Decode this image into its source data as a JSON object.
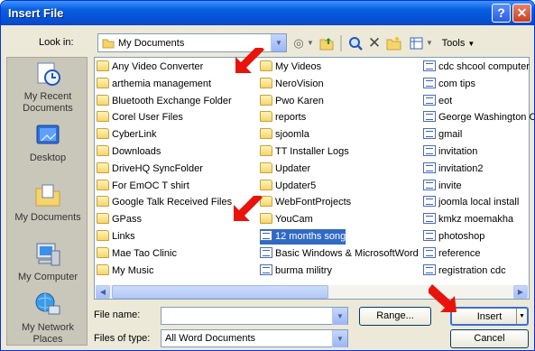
{
  "window": {
    "title": "Insert File",
    "help_label": "?",
    "close_label": "✕"
  },
  "toolbar": {
    "look_in_label": "Look in:",
    "look_in_value": "My Documents",
    "tools_label": "Tools"
  },
  "places": [
    {
      "label": "My Recent Documents",
      "icon": "recent-documents-icon"
    },
    {
      "label": "Desktop",
      "icon": "desktop-icon"
    },
    {
      "label": "My Documents",
      "icon": "my-documents-icon"
    },
    {
      "label": "My Computer",
      "icon": "my-computer-icon"
    },
    {
      "label": "My Network Places",
      "icon": "network-places-icon"
    }
  ],
  "files": {
    "col1": [
      {
        "name": "Any Video Converter",
        "type": "folder"
      },
      {
        "name": "arthemia management",
        "type": "folder"
      },
      {
        "name": "Bluetooth Exchange Folder",
        "type": "folder"
      },
      {
        "name": "Corel User Files",
        "type": "folder"
      },
      {
        "name": "CyberLink",
        "type": "folder"
      },
      {
        "name": "Downloads",
        "type": "folder"
      },
      {
        "name": "DriveHQ SyncFolder",
        "type": "folder"
      },
      {
        "name": "For EmOC T shirt",
        "type": "folder"
      },
      {
        "name": "Google Talk Received Files",
        "type": "folder"
      },
      {
        "name": "GPass",
        "type": "folder"
      },
      {
        "name": "Links",
        "type": "folder"
      },
      {
        "name": "Mae Tao Clinic",
        "type": "folder"
      },
      {
        "name": "My Music",
        "type": "folder"
      }
    ],
    "col2": [
      {
        "name": "My Videos",
        "type": "folder"
      },
      {
        "name": "NeroVision",
        "type": "folder"
      },
      {
        "name": "Pwo Karen",
        "type": "folder"
      },
      {
        "name": "reports",
        "type": "folder"
      },
      {
        "name": "sjoomla",
        "type": "folder"
      },
      {
        "name": "TT Installer Logs",
        "type": "folder"
      },
      {
        "name": "Updater",
        "type": "folder"
      },
      {
        "name": "Updater5",
        "type": "folder"
      },
      {
        "name": "WebFontProjects",
        "type": "folder"
      },
      {
        "name": "YouCam",
        "type": "folder"
      },
      {
        "name": "12 months song",
        "type": "doc",
        "selected": true
      },
      {
        "name": "Basic Windows & MicrosoftWord",
        "type": "doc"
      },
      {
        "name": "burma militry",
        "type": "doc"
      }
    ],
    "col3": [
      {
        "name": "cdc shcool computer",
        "type": "doc"
      },
      {
        "name": "com tips",
        "type": "doc"
      },
      {
        "name": "eot",
        "type": "doc"
      },
      {
        "name": "George Washington C",
        "type": "doc"
      },
      {
        "name": "gmail",
        "type": "doc"
      },
      {
        "name": "invitation",
        "type": "doc"
      },
      {
        "name": "invitation2",
        "type": "doc"
      },
      {
        "name": "invite",
        "type": "doc"
      },
      {
        "name": "joomla local install",
        "type": "doc"
      },
      {
        "name": "kmkz moemakha",
        "type": "doc"
      },
      {
        "name": "photoshop",
        "type": "doc"
      },
      {
        "name": "reference",
        "type": "doc"
      },
      {
        "name": "registration cdc",
        "type": "doc"
      }
    ]
  },
  "form": {
    "file_name_label": "File name:",
    "file_name_value": "",
    "file_type_label": "Files of type:",
    "file_type_value": "All Word Documents",
    "range_label": "Range...",
    "insert_label": "Insert",
    "cancel_label": "Cancel"
  },
  "colors": {
    "annotation_arrow": "#e8140c",
    "selection": "#316ac5",
    "titlebar": "#0a5fe0"
  }
}
